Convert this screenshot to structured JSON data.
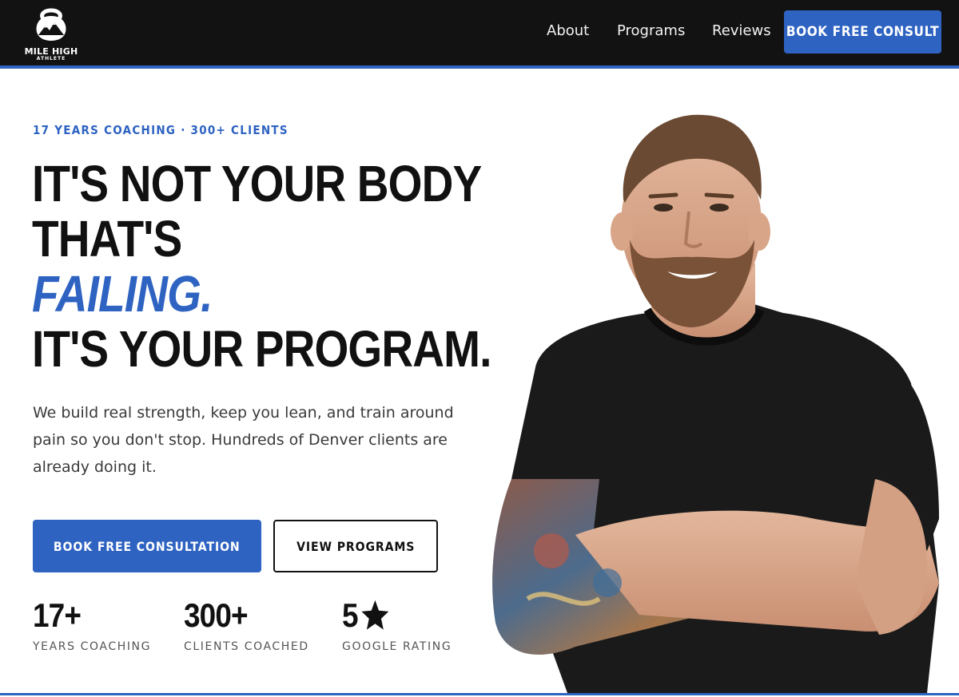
{
  "brand": {
    "name_line1": "MILE HIGH",
    "name_line2": "ATHLETE",
    "icon": "kettlebell-mountain-icon"
  },
  "nav": {
    "links": [
      "About",
      "Programs",
      "Reviews"
    ],
    "cta": "BOOK FREE CONSULT"
  },
  "hero": {
    "eyebrow": "17 YEARS COACHING · 300+ CLIENTS",
    "headline_line1": "IT'S NOT YOUR BODY",
    "headline_line2": "THAT'S",
    "headline_accent": "FAILING.",
    "headline_line4": "IT'S YOUR PROGRAM.",
    "body": "We build real strength, keep you lean, and train around pain so you don't stop. Hundreds of Denver clients are already doing it.",
    "primary_button": "BOOK FREE CONSULTATION",
    "secondary_button": "VIEW PROGRAMS"
  },
  "stats": [
    {
      "value": "17+",
      "label": "YEARS COACHING"
    },
    {
      "value": "300+",
      "label": "CLIENTS COACHED"
    },
    {
      "value": "5",
      "icon": "star-icon",
      "label": "GOOGLE RATING"
    }
  ],
  "colors": {
    "accent": "#2e63c2",
    "nav_bg": "#121212",
    "text": "#111111"
  }
}
